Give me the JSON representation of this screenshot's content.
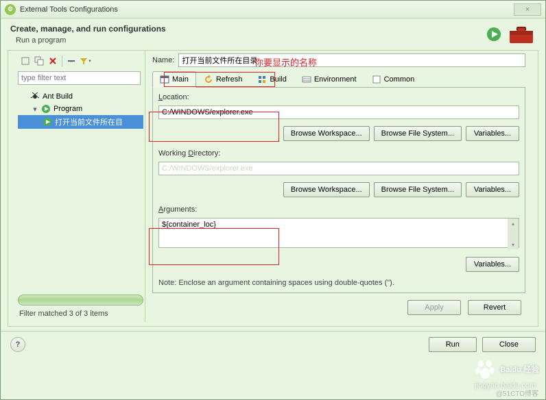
{
  "window": {
    "title": "External Tools Configurations",
    "close_glyph": "×"
  },
  "header": {
    "title": "Create, manage, and run configurations",
    "subtitle": "Run a program"
  },
  "annotation": "你要显示的名称",
  "sidebar": {
    "filter_placeholder": "type filter text",
    "items": [
      {
        "label": "Ant Build",
        "icon": "ant"
      },
      {
        "label": "Program",
        "icon": "program"
      },
      {
        "label": "打开当前文件所在目",
        "icon": "run-config",
        "selected": true
      }
    ],
    "filter_status": "Filter matched 3 of 3 items"
  },
  "content": {
    "name_label": "Name:",
    "name_value": "打开当前文件所在目录",
    "tabs": [
      {
        "label": "Main",
        "active": true
      },
      {
        "label": "Refresh"
      },
      {
        "label": "Build"
      },
      {
        "label": "Environment"
      },
      {
        "label": "Common"
      }
    ],
    "location_label": "Location:",
    "location_value": "C:/WINDOWS/explorer.exe",
    "working_dir_label": "Working Directory:",
    "working_dir_ghost": "C:/WINDOWS/explorer.exe",
    "arguments_label": "Arguments:",
    "arguments_value": "${container_loc}",
    "btn_browse_ws": "Browse Workspace...",
    "btn_browse_fs": "Browse File System...",
    "btn_variables": "Variables...",
    "note": "Note: Enclose an argument containing spaces using double-quotes (\").",
    "btn_apply": "Apply",
    "btn_revert": "Revert"
  },
  "footer": {
    "btn_run": "Run",
    "btn_close": "Close"
  },
  "watermark": {
    "text": "Baidu 经验",
    "sub": "jingyan.baidu.com",
    "corner": "@51CTO博客"
  }
}
